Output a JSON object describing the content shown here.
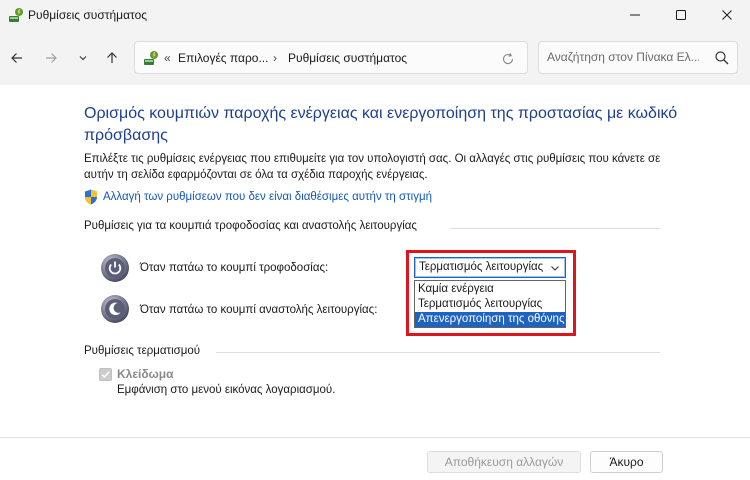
{
  "window": {
    "title": "Ρυθμίσεις συστήματος"
  },
  "nav": {
    "breadcrumb_prefix": "«",
    "breadcrumb": [
      {
        "label": "Επιλογές παρο..."
      },
      {
        "label": "Ρυθμίσεις συστήματος"
      }
    ],
    "breadcrumb_separator": "›",
    "search_placeholder": "Αναζήτηση στον Πίνακα Ελ..."
  },
  "main": {
    "title": "Ορισμός κουμπιών παροχής ενέργειας και ενεργοποίηση της προστασίας με κωδικό πρόσβασης",
    "description": "Επιλέξτε τις ρυθμίσεις ενέργειας που επιθυμείτε για τον υπολογιστή σας. Οι αλλαγές στις ρυθμίσεις που κάνετε σε αυτήν τη σελίδα εφαρμόζονται σε όλα τα σχέδια παροχής ενέργειας.",
    "change_settings_link": "Αλλαγή των ρυθμίσεων που δεν είναι διαθέσιμες αυτήν τη στιγμή",
    "buttons_group": {
      "header": "Ρυθμίσεις για τα κουμπιά τροφοδοσίας και αναστολής λειτουργίας",
      "power_button_label": "Όταν πατάω το κουμπί τροφοδοσίας:",
      "sleep_button_label": "Όταν πατάω το κουμπί αναστολής λειτουργίας:"
    },
    "dropdown": {
      "value": "Τερματισμός λειτουργίας",
      "options": [
        {
          "label": "Καμία ενέργεια"
        },
        {
          "label": "Τερματισμός λειτουργίας"
        },
        {
          "label": "Απενεργοποίηση της οθόνης"
        }
      ],
      "highlighted_index": 2
    },
    "shutdown_group": {
      "header": "Ρυθμίσεις τερματισμού",
      "lock_label": "Κλείδωμα",
      "lock_checked": true,
      "lock_description": "Εμφάνιση στο μενού εικόνας λογαριασμού."
    }
  },
  "footer": {
    "save_label": "Αποθήκευση αλλαγών",
    "cancel_label": "Άκυρο"
  },
  "colors": {
    "title_blue": "#1e3f8f",
    "link_blue": "#1558b8",
    "selection_blue": "#1e63c4",
    "annotation_red": "#e0141e"
  }
}
